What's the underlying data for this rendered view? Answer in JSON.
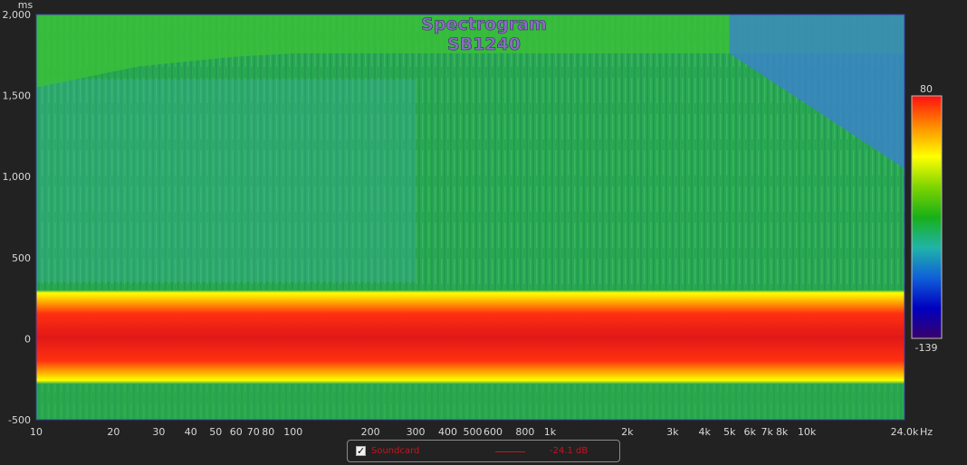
{
  "chart_data": {
    "type": "heatmap",
    "title": "Spectrogram",
    "subtitle": "SB1240",
    "xlabel": "Hz",
    "ylabel": "ms",
    "xscale": "log",
    "xlim": [
      10,
      24000
    ],
    "ylim": [
      -500,
      2000
    ],
    "xticks": [
      {
        "value": 10,
        "label": "10"
      },
      {
        "value": 20,
        "label": "20"
      },
      {
        "value": 30,
        "label": "30"
      },
      {
        "value": 40,
        "label": "40"
      },
      {
        "value": 50,
        "label": "50"
      },
      {
        "value": 60,
        "label": "60"
      },
      {
        "value": 70,
        "label": "70"
      },
      {
        "value": 80,
        "label": "80"
      },
      {
        "value": 100,
        "label": "100"
      },
      {
        "value": 200,
        "label": "200"
      },
      {
        "value": 300,
        "label": "300"
      },
      {
        "value": 400,
        "label": "400"
      },
      {
        "value": 500,
        "label": "500"
      },
      {
        "value": 600,
        "label": "600"
      },
      {
        "value": 800,
        "label": "800"
      },
      {
        "value": 1000,
        "label": "1k"
      },
      {
        "value": 2000,
        "label": "2k"
      },
      {
        "value": 3000,
        "label": "3k"
      },
      {
        "value": 4000,
        "label": "4k"
      },
      {
        "value": 5000,
        "label": "5k"
      },
      {
        "value": 6000,
        "label": "6k"
      },
      {
        "value": 7000,
        "label": "7k"
      },
      {
        "value": 8000,
        "label": "8k"
      },
      {
        "value": 10000,
        "label": "10k"
      },
      {
        "value": 24000,
        "label": "24.0k"
      }
    ],
    "yticks": [
      {
        "value": 2000,
        "label": "2,000"
      },
      {
        "value": 1500,
        "label": "1,500"
      },
      {
        "value": 1000,
        "label": "1,000"
      },
      {
        "value": 500,
        "label": "500"
      },
      {
        "value": 0,
        "label": "0"
      },
      {
        "value": -500,
        "label": "-500"
      }
    ],
    "colorbar": {
      "max": 80,
      "min": -139,
      "max_label": "80",
      "min_label": "-139",
      "colors": [
        "#ff1010",
        "#ff8c00",
        "#ffff00",
        "#7fd400",
        "#18b018",
        "#20b4a8",
        "#1060d8",
        "#0000c0",
        "#3a006a"
      ]
    },
    "impulse_band": {
      "from_ms": -280,
      "to_ms": 300,
      "peak_ms": 0
    },
    "decay_edge": {
      "start_hz": 5000,
      "start_ms": 1760,
      "end_hz": 24000,
      "end_ms": 1050
    },
    "top_edge": [
      {
        "hz": 10,
        "ms": 1550
      },
      {
        "hz": 25,
        "ms": 1680
      },
      {
        "hz": 60,
        "ms": 1740
      },
      {
        "hz": 100,
        "ms": 1760
      },
      {
        "hz": 24000,
        "ms": 1760
      }
    ],
    "plot_colors": {
      "green": "#2aa84a",
      "teal": "#38b0a0",
      "blue": "#3a84c8",
      "top_region": "#3abf3a"
    },
    "legend": [
      {
        "name": "Soundcard",
        "value": "-24.1 dB",
        "checked": true,
        "color": "#c8141e"
      }
    ]
  }
}
